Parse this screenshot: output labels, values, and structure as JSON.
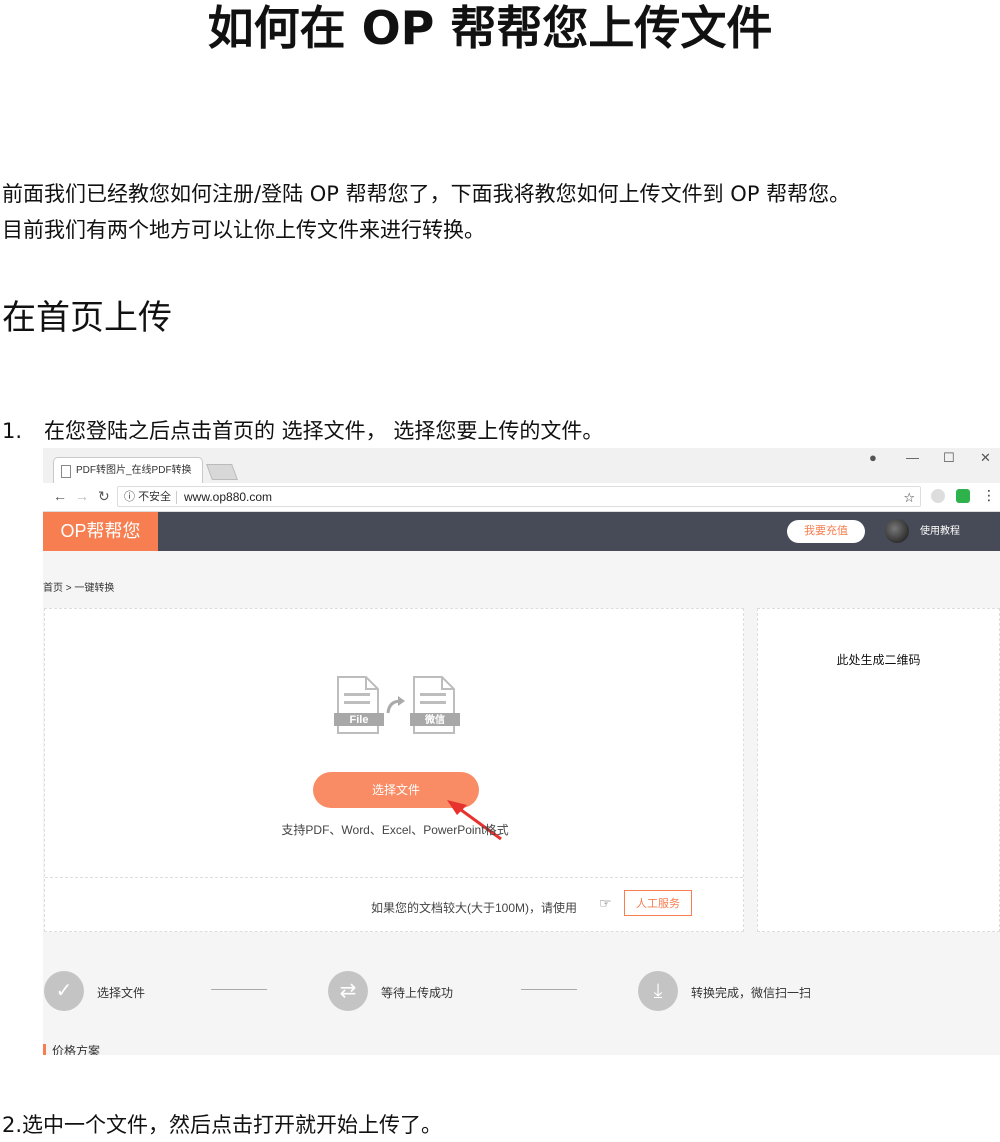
{
  "doc": {
    "title": "如何在 OP 帮帮您上传文件",
    "intro_line1": "前面我们已经教您如何注册/登陆 OP 帮帮您了，下面我将教您如何上传文件到 OP 帮帮您。",
    "intro_line2": "目前我们有两个地方可以让你上传文件来进行转换。",
    "section_heading": "在首页上传",
    "step1_number": "1.",
    "step1_text": "在您登陆之后点击首页的 选择文件， 选择您要上传的文件。",
    "step2_text": "2.选中一个文件，然后点击打开就开始上传了。"
  },
  "browser": {
    "tab_title": "PDF转图片_在线PDF转换",
    "insecure_label": "不安全",
    "url": "www.op880.com"
  },
  "site": {
    "logo": "OP帮帮您",
    "recharge_button": "我要充值",
    "tutorial_link": "使用教程",
    "breadcrumb": "首页 > 一键转换",
    "file_icon_left_label": "File",
    "file_icon_right_label": "微信",
    "select_file_button": "选择文件",
    "supported_formats": "支持PDF、Word、Excel、PowerPoint格式",
    "large_file_notice": "如果您的文档较大(大于100M)，请使用",
    "manual_service_button": "人工服务",
    "qr_placeholder": "此处生成二维码",
    "steps": [
      {
        "label": "选择文件",
        "icon": "check-icon"
      },
      {
        "label": "等待上传成功",
        "icon": "swap-icon"
      },
      {
        "label": "转换完成，微信扫一扫",
        "icon": "download-icon"
      }
    ],
    "pricing_heading": "价格方案"
  },
  "colors": {
    "brand_orange": "#f67e50",
    "header_dark": "#474b57",
    "button_orange": "#f98c65"
  }
}
